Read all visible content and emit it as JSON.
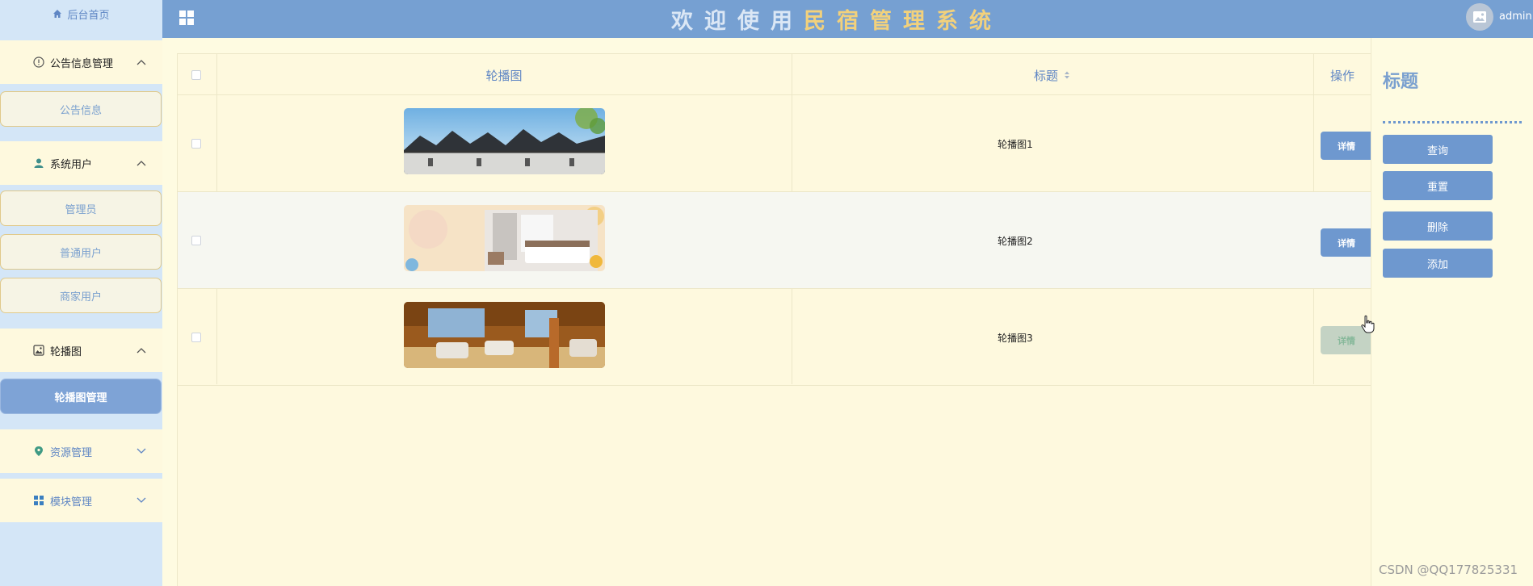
{
  "sidebar": {
    "home": "后台首页",
    "groups": [
      {
        "label": "公告信息管理",
        "icon": "info-circle-icon",
        "expanded": true,
        "items": [
          "公告信息"
        ]
      },
      {
        "label": "系统用户",
        "icon": "user-icon",
        "expanded": true,
        "items": [
          "管理员",
          "普通用户",
          "商家用户"
        ]
      },
      {
        "label": "轮播图",
        "icon": "image-icon",
        "expanded": true,
        "items": [
          "轮播图管理"
        ]
      },
      {
        "label": "资源管理",
        "icon": "location-pin-icon",
        "expanded": false,
        "items": []
      },
      {
        "label": "模块管理",
        "icon": "grid-icon",
        "expanded": false,
        "items": []
      }
    ],
    "active_item": "轮播图管理"
  },
  "header": {
    "title_chars": [
      "欢",
      "迎",
      "使",
      "用",
      "民",
      "宿",
      "管",
      "理",
      "系",
      "统"
    ],
    "user": "admin"
  },
  "table": {
    "columns": [
      "轮播图",
      "标题",
      "操作"
    ],
    "rows": [
      {
        "title": "轮播图1",
        "image": "ancient-village-rooftops",
        "action": "详情"
      },
      {
        "title": "轮播图2",
        "image": "hotel-bedroom",
        "action": "详情"
      },
      {
        "title": "轮播图3",
        "image": "lounge-sofa-room",
        "action": "详情"
      }
    ]
  },
  "panel": {
    "title": "标题",
    "buttons": [
      "查询",
      "重置",
      "删除",
      "添加"
    ]
  },
  "watermark": "CSDN @QQ177825331",
  "colors": {
    "header": "#76a0d2",
    "sidebar": "#d4e6f7",
    "content": "#fef9de",
    "accent": "#6e98cf",
    "title_gold": "#f2d17c"
  }
}
